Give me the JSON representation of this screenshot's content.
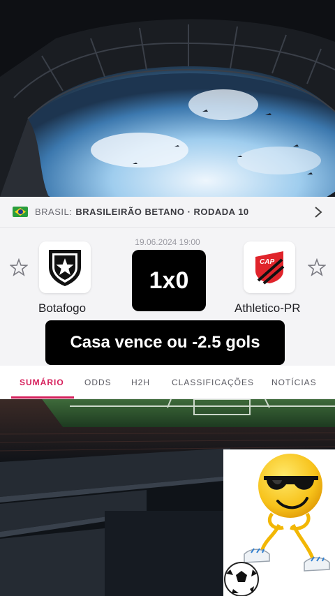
{
  "league": {
    "country": "BRASIL:",
    "name": "BRASILEIRÃO BETANO · RODADA 10"
  },
  "match": {
    "datetime": "19.06.2024 19:00",
    "score": "1x0",
    "home_team": {
      "name": "Botafogo",
      "logo": "botafogo-star-crest"
    },
    "away_team": {
      "name": "Athletico-PR",
      "logo": "athletico-cap-crest"
    },
    "bet_caption": "Casa vence ou -2.5 gols"
  },
  "tabs": [
    {
      "label": "SUMÁRIO",
      "active": true
    },
    {
      "label": "ODDS",
      "active": false
    },
    {
      "label": "H2H",
      "active": false
    },
    {
      "label": "CLASSIFICAÇÕES",
      "active": false
    },
    {
      "label": "NOTÍCIAS",
      "active": false
    }
  ],
  "colors": {
    "accent": "#d61f5b",
    "panel_bg": "#f4f4f6",
    "athletico_red": "#e0242b"
  },
  "icons": {
    "league_flag": "brazil-flag-icon",
    "league_chevron": "chevron-right-icon",
    "favorite": "star-outline-icon",
    "sticker": "cool-emoji-soccer-sticker"
  }
}
